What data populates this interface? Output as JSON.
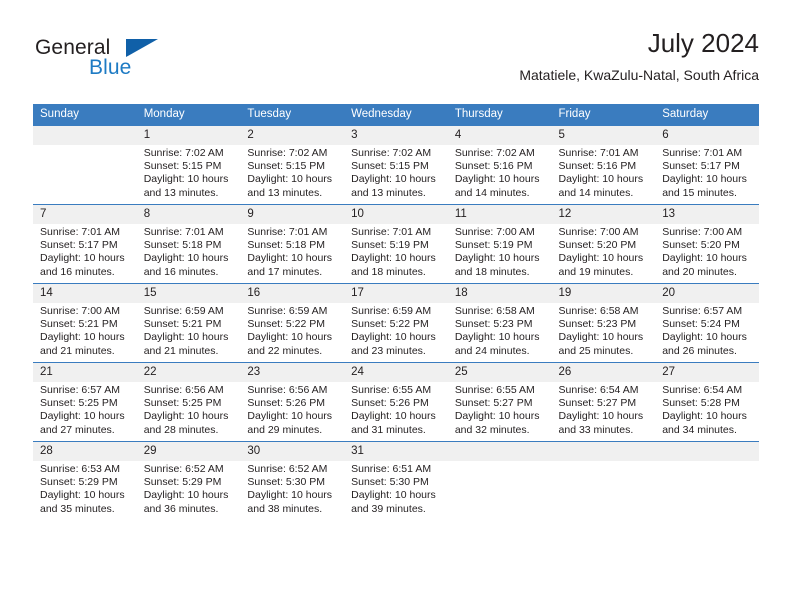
{
  "brand": {
    "name_part1": "General",
    "name_part2": "Blue",
    "colors": {
      "dark": "#231f20",
      "blue": "#1e7bc4",
      "triangle": "#1060a8",
      "header": "#3a7cbf",
      "day_band": "#f0f0f0"
    }
  },
  "header": {
    "title": "July 2024",
    "subtitle": "Matatiele, KwaZulu-Natal, South Africa"
  },
  "weekday_headers": [
    "Sunday",
    "Monday",
    "Tuesday",
    "Wednesday",
    "Thursday",
    "Friday",
    "Saturday"
  ],
  "weeks": [
    [
      {
        "day": "",
        "empty": true,
        "sunrise": "",
        "sunset": "",
        "daylight": ""
      },
      {
        "day": "1",
        "sunrise": "Sunrise: 7:02 AM",
        "sunset": "Sunset: 5:15 PM",
        "daylight": "Daylight: 10 hours and 13 minutes."
      },
      {
        "day": "2",
        "sunrise": "Sunrise: 7:02 AM",
        "sunset": "Sunset: 5:15 PM",
        "daylight": "Daylight: 10 hours and 13 minutes."
      },
      {
        "day": "3",
        "sunrise": "Sunrise: 7:02 AM",
        "sunset": "Sunset: 5:15 PM",
        "daylight": "Daylight: 10 hours and 13 minutes."
      },
      {
        "day": "4",
        "sunrise": "Sunrise: 7:02 AM",
        "sunset": "Sunset: 5:16 PM",
        "daylight": "Daylight: 10 hours and 14 minutes."
      },
      {
        "day": "5",
        "sunrise": "Sunrise: 7:01 AM",
        "sunset": "Sunset: 5:16 PM",
        "daylight": "Daylight: 10 hours and 14 minutes."
      },
      {
        "day": "6",
        "sunrise": "Sunrise: 7:01 AM",
        "sunset": "Sunset: 5:17 PM",
        "daylight": "Daylight: 10 hours and 15 minutes."
      }
    ],
    [
      {
        "day": "7",
        "sunrise": "Sunrise: 7:01 AM",
        "sunset": "Sunset: 5:17 PM",
        "daylight": "Daylight: 10 hours and 16 minutes."
      },
      {
        "day": "8",
        "sunrise": "Sunrise: 7:01 AM",
        "sunset": "Sunset: 5:18 PM",
        "daylight": "Daylight: 10 hours and 16 minutes."
      },
      {
        "day": "9",
        "sunrise": "Sunrise: 7:01 AM",
        "sunset": "Sunset: 5:18 PM",
        "daylight": "Daylight: 10 hours and 17 minutes."
      },
      {
        "day": "10",
        "sunrise": "Sunrise: 7:01 AM",
        "sunset": "Sunset: 5:19 PM",
        "daylight": "Daylight: 10 hours and 18 minutes."
      },
      {
        "day": "11",
        "sunrise": "Sunrise: 7:00 AM",
        "sunset": "Sunset: 5:19 PM",
        "daylight": "Daylight: 10 hours and 18 minutes."
      },
      {
        "day": "12",
        "sunrise": "Sunrise: 7:00 AM",
        "sunset": "Sunset: 5:20 PM",
        "daylight": "Daylight: 10 hours and 19 minutes."
      },
      {
        "day": "13",
        "sunrise": "Sunrise: 7:00 AM",
        "sunset": "Sunset: 5:20 PM",
        "daylight": "Daylight: 10 hours and 20 minutes."
      }
    ],
    [
      {
        "day": "14",
        "sunrise": "Sunrise: 7:00 AM",
        "sunset": "Sunset: 5:21 PM",
        "daylight": "Daylight: 10 hours and 21 minutes."
      },
      {
        "day": "15",
        "sunrise": "Sunrise: 6:59 AM",
        "sunset": "Sunset: 5:21 PM",
        "daylight": "Daylight: 10 hours and 21 minutes."
      },
      {
        "day": "16",
        "sunrise": "Sunrise: 6:59 AM",
        "sunset": "Sunset: 5:22 PM",
        "daylight": "Daylight: 10 hours and 22 minutes."
      },
      {
        "day": "17",
        "sunrise": "Sunrise: 6:59 AM",
        "sunset": "Sunset: 5:22 PM",
        "daylight": "Daylight: 10 hours and 23 minutes."
      },
      {
        "day": "18",
        "sunrise": "Sunrise: 6:58 AM",
        "sunset": "Sunset: 5:23 PM",
        "daylight": "Daylight: 10 hours and 24 minutes."
      },
      {
        "day": "19",
        "sunrise": "Sunrise: 6:58 AM",
        "sunset": "Sunset: 5:23 PM",
        "daylight": "Daylight: 10 hours and 25 minutes."
      },
      {
        "day": "20",
        "sunrise": "Sunrise: 6:57 AM",
        "sunset": "Sunset: 5:24 PM",
        "daylight": "Daylight: 10 hours and 26 minutes."
      }
    ],
    [
      {
        "day": "21",
        "sunrise": "Sunrise: 6:57 AM",
        "sunset": "Sunset: 5:25 PM",
        "daylight": "Daylight: 10 hours and 27 minutes."
      },
      {
        "day": "22",
        "sunrise": "Sunrise: 6:56 AM",
        "sunset": "Sunset: 5:25 PM",
        "daylight": "Daylight: 10 hours and 28 minutes."
      },
      {
        "day": "23",
        "sunrise": "Sunrise: 6:56 AM",
        "sunset": "Sunset: 5:26 PM",
        "daylight": "Daylight: 10 hours and 29 minutes."
      },
      {
        "day": "24",
        "sunrise": "Sunrise: 6:55 AM",
        "sunset": "Sunset: 5:26 PM",
        "daylight": "Daylight: 10 hours and 31 minutes."
      },
      {
        "day": "25",
        "sunrise": "Sunrise: 6:55 AM",
        "sunset": "Sunset: 5:27 PM",
        "daylight": "Daylight: 10 hours and 32 minutes."
      },
      {
        "day": "26",
        "sunrise": "Sunrise: 6:54 AM",
        "sunset": "Sunset: 5:27 PM",
        "daylight": "Daylight: 10 hours and 33 minutes."
      },
      {
        "day": "27",
        "sunrise": "Sunrise: 6:54 AM",
        "sunset": "Sunset: 5:28 PM",
        "daylight": "Daylight: 10 hours and 34 minutes."
      }
    ],
    [
      {
        "day": "28",
        "sunrise": "Sunrise: 6:53 AM",
        "sunset": "Sunset: 5:29 PM",
        "daylight": "Daylight: 10 hours and 35 minutes."
      },
      {
        "day": "29",
        "sunrise": "Sunrise: 6:52 AM",
        "sunset": "Sunset: 5:29 PM",
        "daylight": "Daylight: 10 hours and 36 minutes."
      },
      {
        "day": "30",
        "sunrise": "Sunrise: 6:52 AM",
        "sunset": "Sunset: 5:30 PM",
        "daylight": "Daylight: 10 hours and 38 minutes."
      },
      {
        "day": "31",
        "sunrise": "Sunrise: 6:51 AM",
        "sunset": "Sunset: 5:30 PM",
        "daylight": "Daylight: 10 hours and 39 minutes."
      },
      {
        "day": "",
        "empty": true,
        "sunrise": "",
        "sunset": "",
        "daylight": ""
      },
      {
        "day": "",
        "empty": true,
        "sunrise": "",
        "sunset": "",
        "daylight": ""
      },
      {
        "day": "",
        "empty": true,
        "sunrise": "",
        "sunset": "",
        "daylight": ""
      }
    ]
  ]
}
